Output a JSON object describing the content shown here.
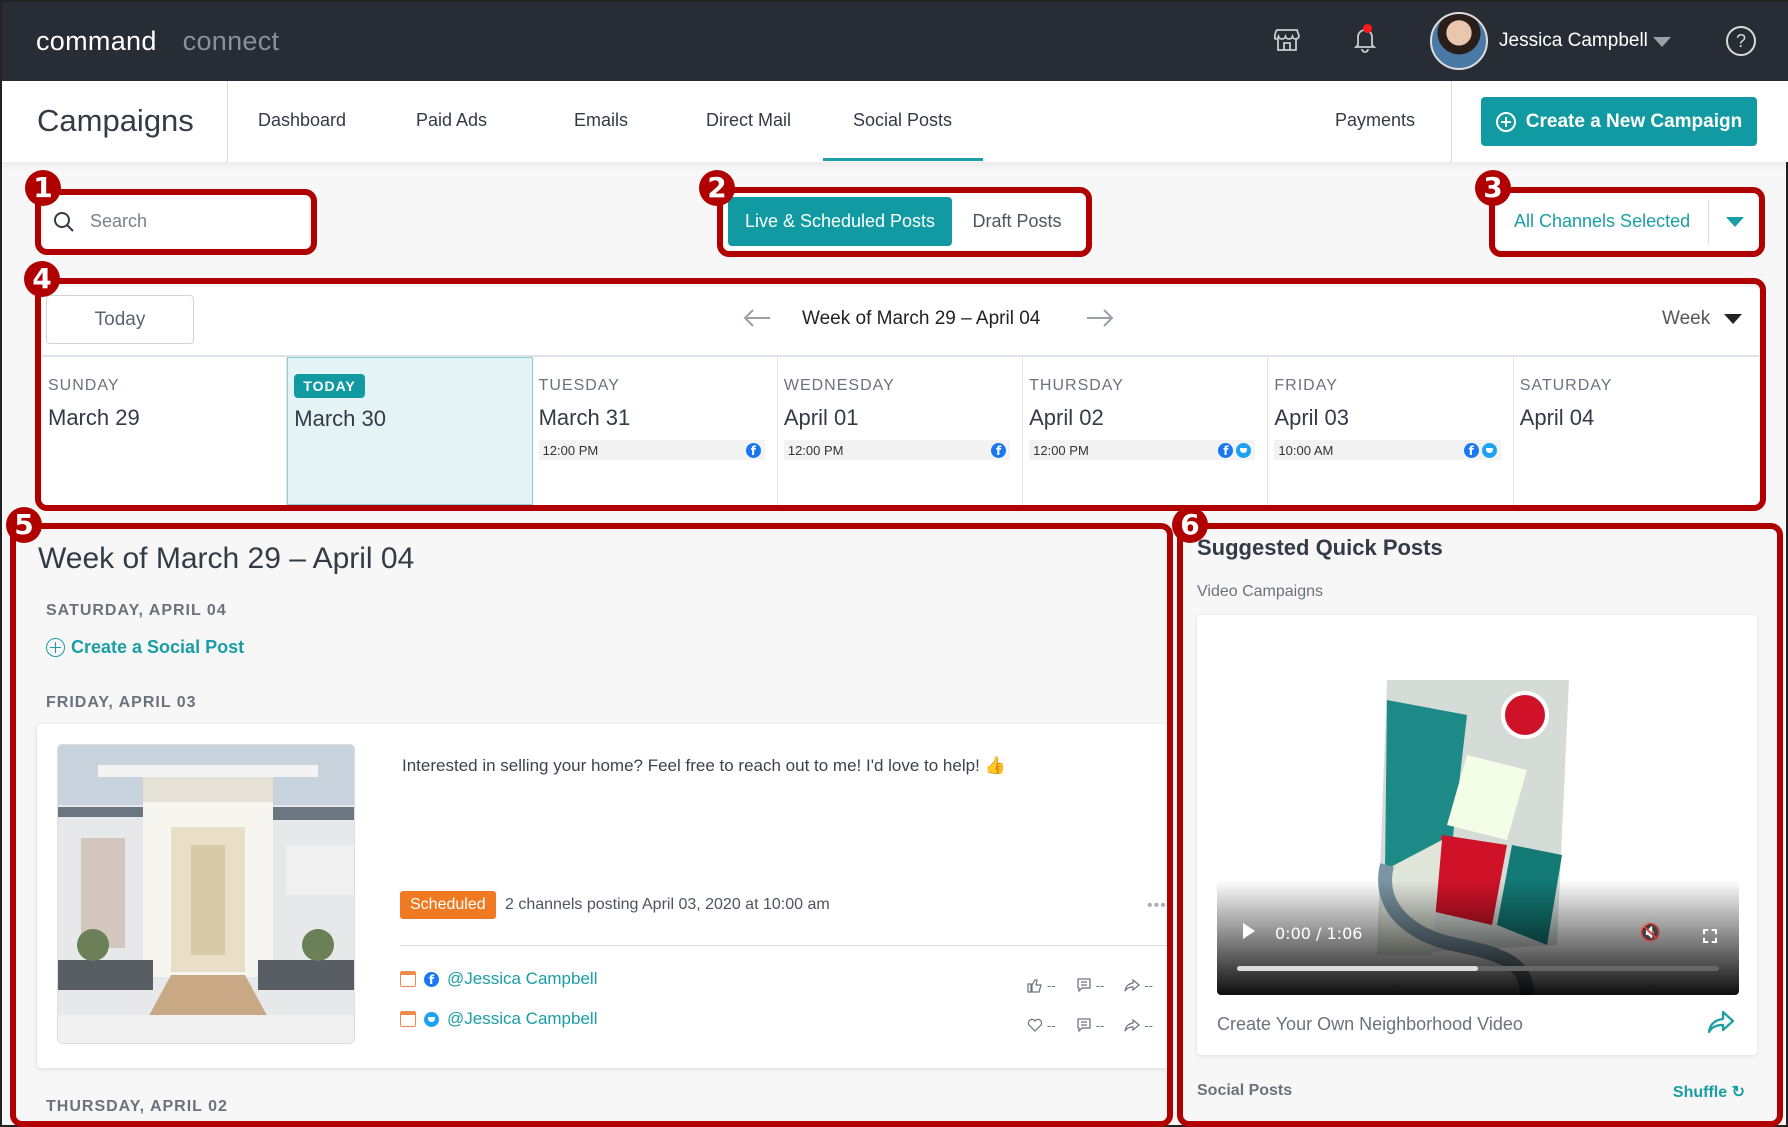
{
  "topbar": {
    "brand_primary": "command",
    "brand_secondary": "connect",
    "user_name": "Jessica Campbell",
    "help_label": "?"
  },
  "nav": {
    "title": "Campaigns",
    "items": [
      "Dashboard",
      "Paid Ads",
      "Emails",
      "Direct Mail",
      "Social Posts"
    ],
    "active": "Social Posts",
    "payments": "Payments",
    "create_button": "Create a New Campaign"
  },
  "annotations": [
    "1",
    "2",
    "3",
    "4",
    "5",
    "6"
  ],
  "search": {
    "placeholder": "Search"
  },
  "post_toggle": {
    "live": "Live & Scheduled Posts",
    "draft": "Draft Posts",
    "selected": "Live & Scheduled Posts"
  },
  "channel_select": {
    "value": "All Channels Selected"
  },
  "calendar": {
    "today_button": "Today",
    "title": "Week of March 29 – April 04",
    "view": "Week",
    "today_badge": "TODAY",
    "days": [
      {
        "name": "SUNDAY",
        "date": "March 29",
        "events": []
      },
      {
        "name": "TODAY",
        "date": "March 30",
        "today": true,
        "events": []
      },
      {
        "name": "TUESDAY",
        "date": "March 31",
        "events": [
          {
            "time": "12:00 PM",
            "channels": [
              "facebook"
            ]
          }
        ]
      },
      {
        "name": "WEDNESDAY",
        "date": "April 01",
        "events": [
          {
            "time": "12:00 PM",
            "channels": [
              "facebook"
            ]
          }
        ]
      },
      {
        "name": "THURSDAY",
        "date": "April 02",
        "events": [
          {
            "time": "12:00 PM",
            "channels": [
              "facebook",
              "twitter"
            ]
          }
        ]
      },
      {
        "name": "FRIDAY",
        "date": "April 03",
        "events": [
          {
            "time": "10:00 AM",
            "channels": [
              "facebook",
              "twitter"
            ]
          }
        ]
      },
      {
        "name": "SATURDAY",
        "date": "April 04",
        "events": []
      }
    ]
  },
  "week_list": {
    "title": "Week of March 29 – April 04",
    "sections": [
      {
        "label": "SATURDAY, APRIL 04",
        "action": "Create a Social Post"
      },
      {
        "label": "FRIDAY, APRIL 03"
      },
      {
        "label": "THURSDAY, APRIL 02"
      }
    ],
    "post": {
      "text": "Interested in selling your home? Feel free to reach out to me! I'd love to help! 👍",
      "status": "Scheduled",
      "schedule_info": "2 channels posting April 03, 2020 at 10:00 am",
      "more": "•••",
      "channels": [
        {
          "network": "facebook",
          "handle": "@Jessica Campbell",
          "likes": "--",
          "comments": "--",
          "shares": "--"
        },
        {
          "network": "twitter",
          "handle": "@Jessica Campbell",
          "likes": "--",
          "comments": "--",
          "shares": "--"
        }
      ]
    }
  },
  "suggested": {
    "title": "Suggested Quick Posts",
    "video_section": "Video Campaigns",
    "video": {
      "time": "0:00 / 1:06",
      "buffered_fraction": 0.5,
      "label": "Create Your Own Neighborhood Video"
    },
    "social_section": "Social Posts",
    "shuffle": "Shuffle"
  },
  "colors": {
    "accent": "#129aa3",
    "topbar": "#282c35",
    "scheduled": "#ef7a22",
    "annotation": "#b00000",
    "facebook": "#1877f2",
    "twitter": "#1da1f2"
  }
}
